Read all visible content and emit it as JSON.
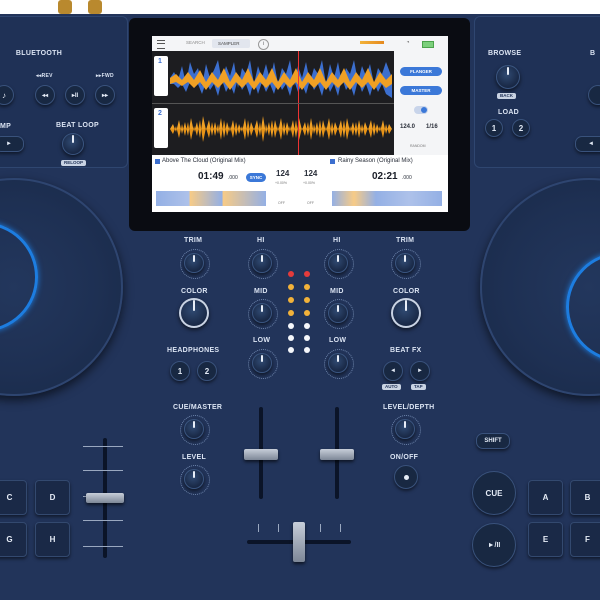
{
  "left": {
    "bluetooth": "BLUETOOTH",
    "rev": "◂◂REV",
    "fwd": "▸▸FWD",
    "beat_loop": "BEAT LOOP",
    "reloop": "RELOOP",
    "amp_partial": "MP",
    "pads": [
      "C",
      "D",
      "G",
      "H"
    ]
  },
  "screen": {
    "tab_search": "SEARCH",
    "tab_samplerplay": "SAMPLER",
    "deck1_num": "1",
    "deck2_num": "2",
    "deck1_title": "Above The Cloud (Original Mix)",
    "deck2_title": "Rainy Season (Original Mix)",
    "deck1_time": "01:49",
    "deck1_ms": ".000",
    "deck2_time": "02:21",
    "deck2_ms": ".000",
    "deck1_bpm": "124",
    "deck2_bpm": "124",
    "deck1_sync": "SYNC",
    "side_flanger": "FLANGER",
    "side_master": "MASTER",
    "side_bpm": "124.0",
    "side_beat": "1/16",
    "side_random": "RANDOM",
    "deck1_pct": "+0.00%",
    "deck2_pct": "+0.00%",
    "deck1_off": "OFF",
    "deck2_off": "OFF"
  },
  "mixer": {
    "trim": "TRIM",
    "hi": "HI",
    "mid": "MID",
    "low": "LOW",
    "color": "COLOR",
    "headphones": "HEADPHONES",
    "cue_master": "CUE/MASTER",
    "level": "LEVEL",
    "beat_fx": "BEAT FX",
    "auto": "AUTO",
    "tap": "TAP",
    "level_depth": "LEVEL/DEPTH",
    "on_off": "ON/OFF",
    "hp1": "1",
    "hp2": "2"
  },
  "right": {
    "browse": "BROWSE",
    "back": "BACK",
    "load": "LOAD",
    "load1": "1",
    "load2": "2",
    "shift": "SHIFT",
    "cue": "CUE",
    "play_pause": "►/II",
    "pads": [
      "A",
      "B",
      "E",
      "F"
    ],
    "partial_b": "B"
  },
  "colors": {
    "body": "#22345a",
    "accent_ring": "#1d7de0",
    "waveform_blue": "#3c6fcf",
    "waveform_orange": "#f0a024",
    "led_red": "#e53b3b",
    "led_amber": "#f2b23a",
    "led_white": "#f5f7fb"
  }
}
